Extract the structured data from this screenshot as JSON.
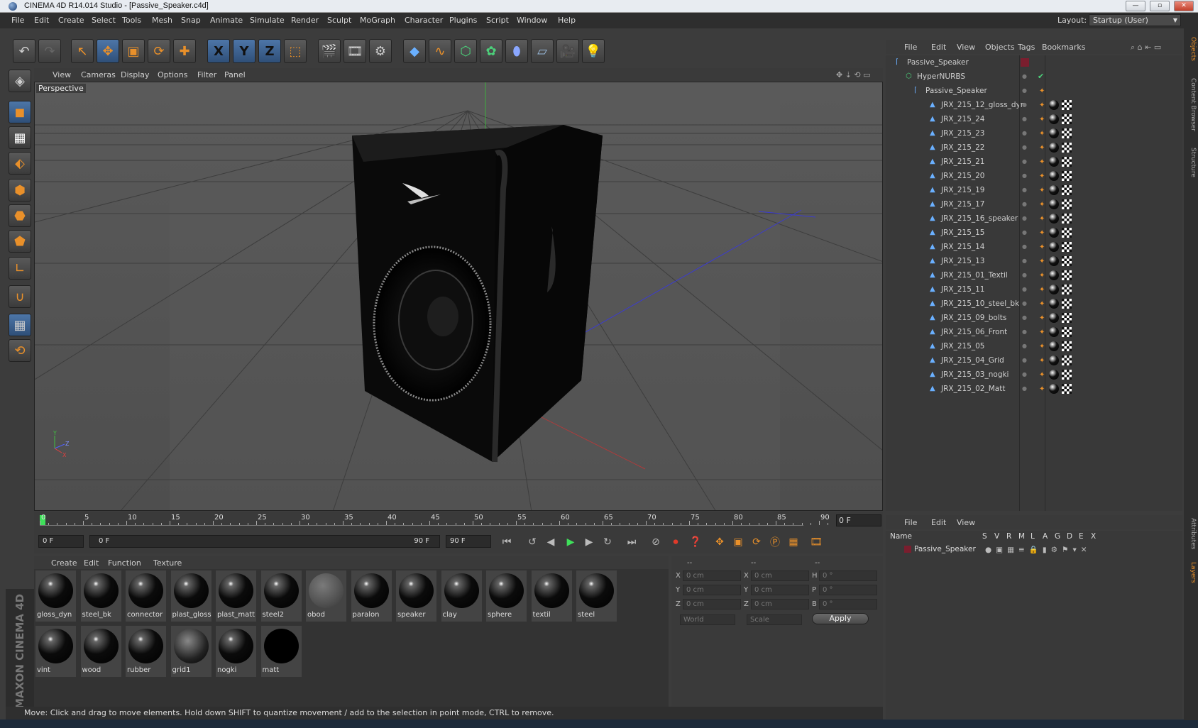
{
  "window": {
    "title": "CINEMA 4D R14.014 Studio - [Passive_Speaker.c4d]",
    "controls": [
      "—",
      "▫",
      "✕"
    ]
  },
  "menubar": {
    "items": [
      "File",
      "Edit",
      "Create",
      "Select",
      "Tools",
      "Mesh",
      "Snap",
      "Animate",
      "Simulate",
      "Render",
      "Sculpt",
      "MoGraph",
      "Character",
      "Plugins",
      "Script",
      "Window",
      "Help"
    ],
    "layout_label": "Layout:",
    "layout_value": "Startup (User)"
  },
  "toolbar": {
    "axis_x": "X",
    "axis_y": "Y",
    "axis_z": "Z"
  },
  "viewport": {
    "menu": [
      "View",
      "Cameras",
      "Display",
      "Options",
      "Filter",
      "Panel"
    ],
    "camera_label": "Perspective",
    "axis_y": "Y",
    "axis_z": "Z",
    "axis_x": "X"
  },
  "timeline": {
    "ticks": [
      "0",
      "5",
      "10",
      "15",
      "20",
      "25",
      "30",
      "35",
      "40",
      "45",
      "50",
      "55",
      "60",
      "65",
      "70",
      "75",
      "80",
      "85",
      "90"
    ],
    "current_frame": "0 F"
  },
  "transport": {
    "start": "0 F",
    "range_start": "0 F",
    "range_end": "90 F",
    "end": "90 F"
  },
  "materials": {
    "menu": [
      "Create",
      "Edit",
      "Function",
      "Texture"
    ],
    "row1": [
      "gloss_dyn",
      "steel_bk",
      "connector",
      "plast_gloss",
      "plast_matt",
      "steel2",
      "obod",
      "paralon",
      "speaker",
      "clay",
      "sphere",
      "textil",
      "steel"
    ],
    "row2": [
      "vint",
      "wood",
      "rubber",
      "grid1",
      "nogki",
      "matt"
    ]
  },
  "coordinates": {
    "header": [
      "--",
      "--",
      "--"
    ],
    "rows": [
      {
        "a": "X",
        "av": "0 cm",
        "b": "X",
        "bv": "0 cm",
        "c": "H",
        "cv": "0 °"
      },
      {
        "a": "Y",
        "av": "0 cm",
        "b": "Y",
        "bv": "0 cm",
        "c": "P",
        "cv": "0 °"
      },
      {
        "a": "Z",
        "av": "0 cm",
        "b": "Z",
        "bv": "0 cm",
        "c": "B",
        "cv": "0 °"
      }
    ],
    "space": "World",
    "mode": "Scale",
    "apply": "Apply"
  },
  "status": "Move: Click and drag to move elements. Hold down SHIFT to quantize movement / add to the selection in point mode, CTRL to remove.",
  "objects": {
    "menu": [
      "File",
      "Edit",
      "View",
      "Objects",
      "Tags",
      "Bookmarks"
    ],
    "items": [
      "Passive_Speaker",
      "HyperNURBS",
      "Passive_Speaker",
      "JRX_215_12_gloss_dyn",
      "JRX_215_24",
      "JRX_215_23",
      "JRX_215_22",
      "JRX_215_21",
      "JRX_215_20",
      "JRX_215_19",
      "JRX_215_17",
      "JRX_215_16_speaker",
      "JRX_215_15",
      "JRX_215_14",
      "JRX_215_13",
      "JRX_215_01_Textil",
      "JRX_215_11",
      "JRX_215_10_steel_bk",
      "JRX_215_09_bolts",
      "JRX_215_06_Front",
      "JRX_215_05",
      "JRX_215_04_Grid",
      "JRX_215_03_nogki",
      "JRX_215_02_Matt"
    ]
  },
  "layers": {
    "menu": [
      "File",
      "Edit",
      "View"
    ],
    "columns": [
      "Name",
      "S",
      "V",
      "R",
      "M",
      "L",
      "A",
      "G",
      "D",
      "E",
      "X"
    ],
    "row": "Passive_Speaker"
  },
  "side_tabs": [
    "Objects",
    "Content Browser",
    "Structure",
    "Attributes",
    "Layers"
  ],
  "brand": "MAXON CINEMA 4D",
  "colors": {
    "accent": "#e9902a",
    "selection": "#4d76a8",
    "bg": "#3c3c3c"
  }
}
